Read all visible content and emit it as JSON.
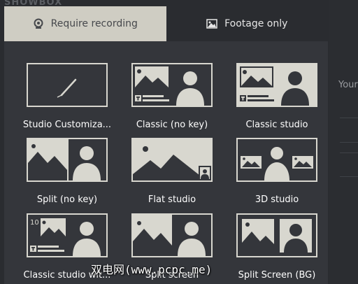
{
  "background": {
    "logo_text": "SHOWBOX",
    "side_text": "Your"
  },
  "tabs": [
    {
      "label": "Require recording",
      "icon": "webcam-icon",
      "active": true
    },
    {
      "label": "Footage only",
      "icon": "image-icon",
      "active": false
    }
  ],
  "layouts": [
    {
      "label": "Studio Customiza...",
      "icon": "pen-icon"
    },
    {
      "label": "Classic (no key)",
      "icon": "classic-no-key-icon"
    },
    {
      "label": "Classic studio",
      "icon": "classic-studio-icon"
    },
    {
      "label": "Split (no key)",
      "icon": "split-no-key-icon"
    },
    {
      "label": "Flat studio",
      "icon": "flat-studio-icon"
    },
    {
      "label": "3D studio",
      "icon": "3d-studio-icon"
    },
    {
      "label": "Classic studio wit...",
      "icon": "classic-studio-with-icon"
    },
    {
      "label": "Split screen",
      "icon": "split-screen-icon"
    },
    {
      "label": "Split Screen (BG)",
      "icon": "split-screen-bg-icon"
    }
  ],
  "thumb_badge": "10",
  "watermark": "双电网(www.pcpc.me)",
  "colors": {
    "panel": "#34363b",
    "active_tab": "#cfcdc3",
    "thumb_fill": "#d8d7cf"
  }
}
